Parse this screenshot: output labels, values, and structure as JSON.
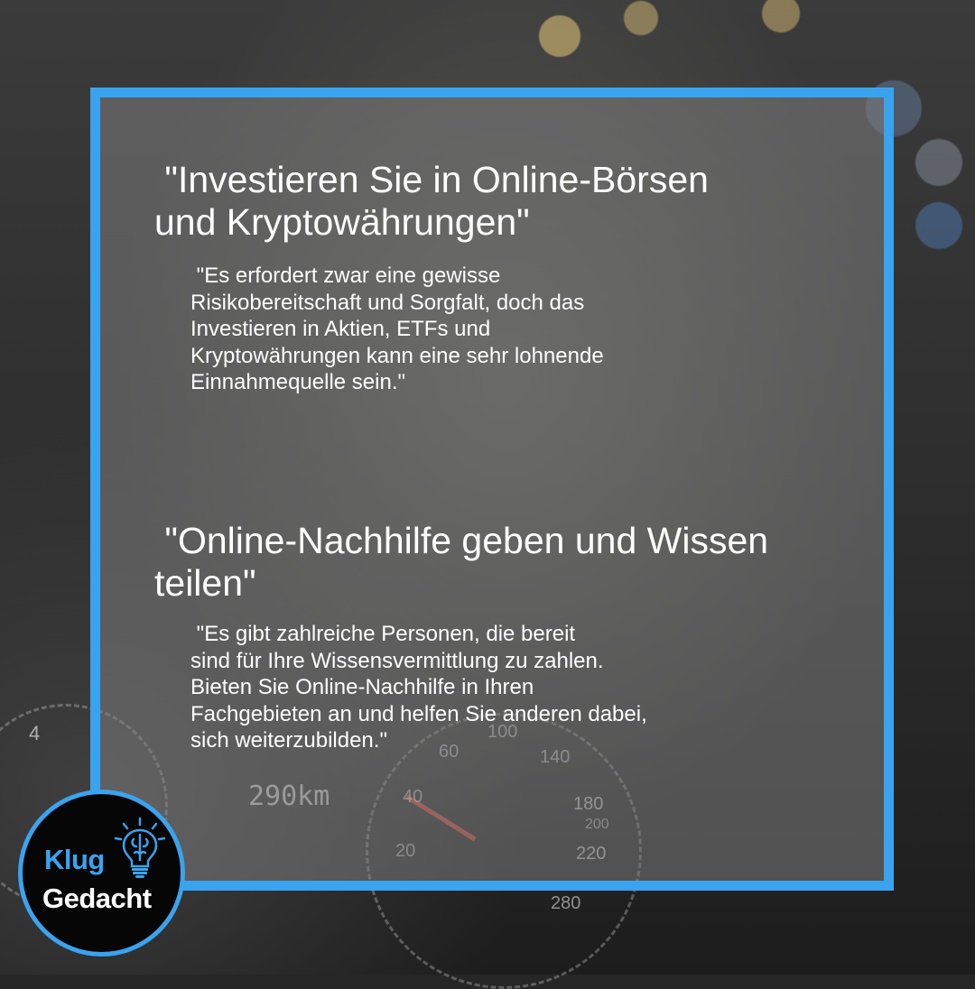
{
  "card1": {
    "heading": " \"Investieren Sie in Online-Börsen\nund Kryptowährungen\"",
    "body": " \"Es erfordert zwar eine gewisse\nRisikobereitschaft und Sorgfalt, doch das\nInvestieren in Aktien, ETFs und\nKryptowährungen kann eine sehr lohnende\nEinnahmequelle sein.\""
  },
  "card2": {
    "heading": " \"Online-Nachhilfe geben und Wissen\nteilen\"",
    "body": " \"Es gibt zahlreiche Personen, die bereit\nsind für Ihre Wissensvermittlung zu zahlen.\nBieten Sie Online-Nachhilfe in Ihren\nFachgebieten an und helfen Sie anderen dabei,\nsich weiterzubilden.\""
  },
  "background": {
    "odometer": "290km",
    "speed_marks": [
      "20",
      "40",
      "60",
      "100",
      "140",
      "180",
      "200",
      "220",
      "280"
    ],
    "rpm_mark": "4"
  },
  "logo": {
    "line1": "Klug",
    "line2": "Gedacht",
    "icon": "lightbulb-brain-icon"
  },
  "colors": {
    "accent": "#3aa3ef",
    "text": "#ffffff",
    "panel": "#808080"
  }
}
